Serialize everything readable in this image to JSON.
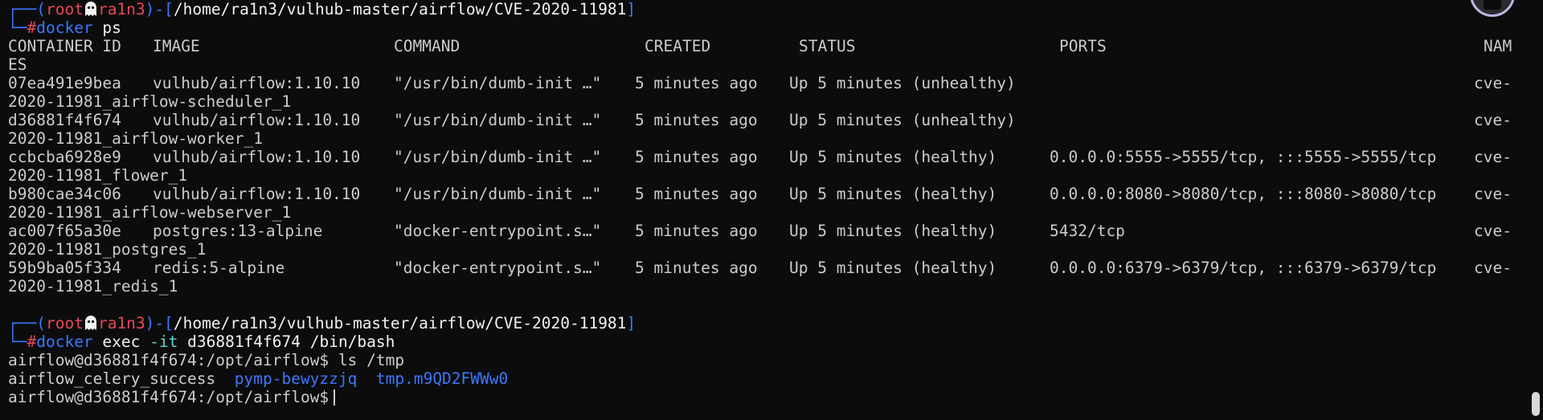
{
  "prompt1": {
    "corner": "┌──",
    "lparen": "(",
    "user": "root",
    "host": "ra1n3",
    "rparen": ")-[",
    "path": "/home/ra1n3/vulhub-master/airflow/CVE-2020-11981",
    "rbracket": "]",
    "corner2": "└─",
    "hash": "#",
    "cmd_name": "docker",
    "cmd_args": " ps"
  },
  "ps_headers": {
    "container_id": "CONTAINER ID",
    "image": "IMAGE",
    "command": "COMMAND",
    "created": "CREATED",
    "status": "STATUS",
    "ports": "PORTS",
    "names_a": "NAM",
    "names_b": "ES"
  },
  "ps_rows": [
    {
      "id": "07ea491e9bea",
      "image": "vulhub/airflow:1.10.10",
      "command": "\"/usr/bin/dumb-init …\"",
      "created": "5 minutes ago",
      "status": "Up 5 minutes (unhealthy)",
      "ports": "",
      "name_a": "cve-",
      "name_b": "2020-11981_airflow-scheduler_1"
    },
    {
      "id": "d36881f4f674",
      "image": "vulhub/airflow:1.10.10",
      "command": "\"/usr/bin/dumb-init …\"",
      "created": "5 minutes ago",
      "status": "Up 5 minutes (unhealthy)",
      "ports": "",
      "name_a": "cve-",
      "name_b": "2020-11981_airflow-worker_1"
    },
    {
      "id": "ccbcba6928e9",
      "image": "vulhub/airflow:1.10.10",
      "command": "\"/usr/bin/dumb-init …\"",
      "created": "5 minutes ago",
      "status": "Up 5 minutes (healthy)",
      "ports": "0.0.0.0:5555->5555/tcp, :::5555->5555/tcp",
      "name_a": "cve-",
      "name_b": "2020-11981_flower_1"
    },
    {
      "id": "b980cae34c06",
      "image": "vulhub/airflow:1.10.10",
      "command": "\"/usr/bin/dumb-init …\"",
      "created": "5 minutes ago",
      "status": "Up 5 minutes (healthy)",
      "ports": "0.0.0.0:8080->8080/tcp, :::8080->8080/tcp",
      "name_a": "cve-",
      "name_b": "2020-11981_airflow-webserver_1"
    },
    {
      "id": "ac007f65a30e",
      "image": "postgres:13-alpine",
      "command": "\"docker-entrypoint.s…\"",
      "created": "5 minutes ago",
      "status": "Up 5 minutes (healthy)",
      "ports": "5432/tcp",
      "name_a": "cve-",
      "name_b": "2020-11981_postgres_1"
    },
    {
      "id": "59b9ba05f334",
      "image": "redis:5-alpine",
      "command": "\"docker-entrypoint.s…\"",
      "created": "5 minutes ago",
      "status": "Up 5 minutes (healthy)",
      "ports": "0.0.0.0:6379->6379/tcp, :::6379->6379/tcp",
      "name_a": "cve-",
      "name_b": "2020-11981_redis_1"
    }
  ],
  "prompt2": {
    "corner": "┌──",
    "lparen": "(",
    "user": "root",
    "host": "ra1n3",
    "rparen": ")-[",
    "path": "/home/ra1n3/vulhub-master/airflow/CVE-2020-11981",
    "rbracket": "]",
    "corner2": "└─",
    "hash": "#",
    "cmd_name": "docker",
    "cmd_sub": " exec ",
    "cmd_flag": "-it",
    "cmd_rest": " d36881f4f674 /bin/bash"
  },
  "shell": {
    "prompt": "airflow@d36881f4f674:/opt/airflow$",
    "ls_cmd": " ls /tmp",
    "ls_out_1": "airflow_celery_success",
    "ls_out_2": "pymp-bewyzzjq",
    "ls_out_3": "tmp.m9QD2FWWw0",
    "final_prompt": "airflow@d36881f4f674:/opt/airflow$"
  },
  "colors": {
    "background": "#0c0c0c",
    "text": "#cccccc",
    "prompt_frame": "#3b78ff",
    "root_user": "#e74856",
    "directory_listing": "#3b78ff"
  }
}
